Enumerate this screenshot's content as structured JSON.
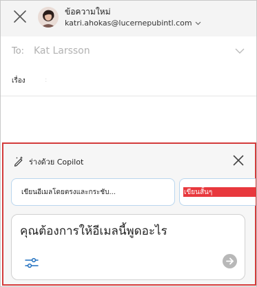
{
  "header": {
    "title": "ข้อความใหม่",
    "from_address": "katri.ahokas@lucernepubintl.com"
  },
  "to_row": {
    "label": "To:",
    "recipient": "Kat Larsson"
  },
  "subject_row": {
    "label": "เรื่อง",
    "caret": ":"
  },
  "copilot": {
    "title": "ร่างด้วย Copilot",
    "suggestions": [
      "เขียนอีเมลโดยตรงและกระชับ...",
      "เขียนสั้นๆ"
    ],
    "prompt_placeholder": "คุณต้องการให้อีเมลนี้พูดอะไร",
    "highlight_color": "#d33a3a"
  },
  "icons": {
    "close": "close-icon",
    "avatar": "avatar",
    "chevron": "chevron-down-icon",
    "copilot": "pen-sparkle-icon",
    "tune": "sliders-icon",
    "send": "arrow-right-icon"
  }
}
